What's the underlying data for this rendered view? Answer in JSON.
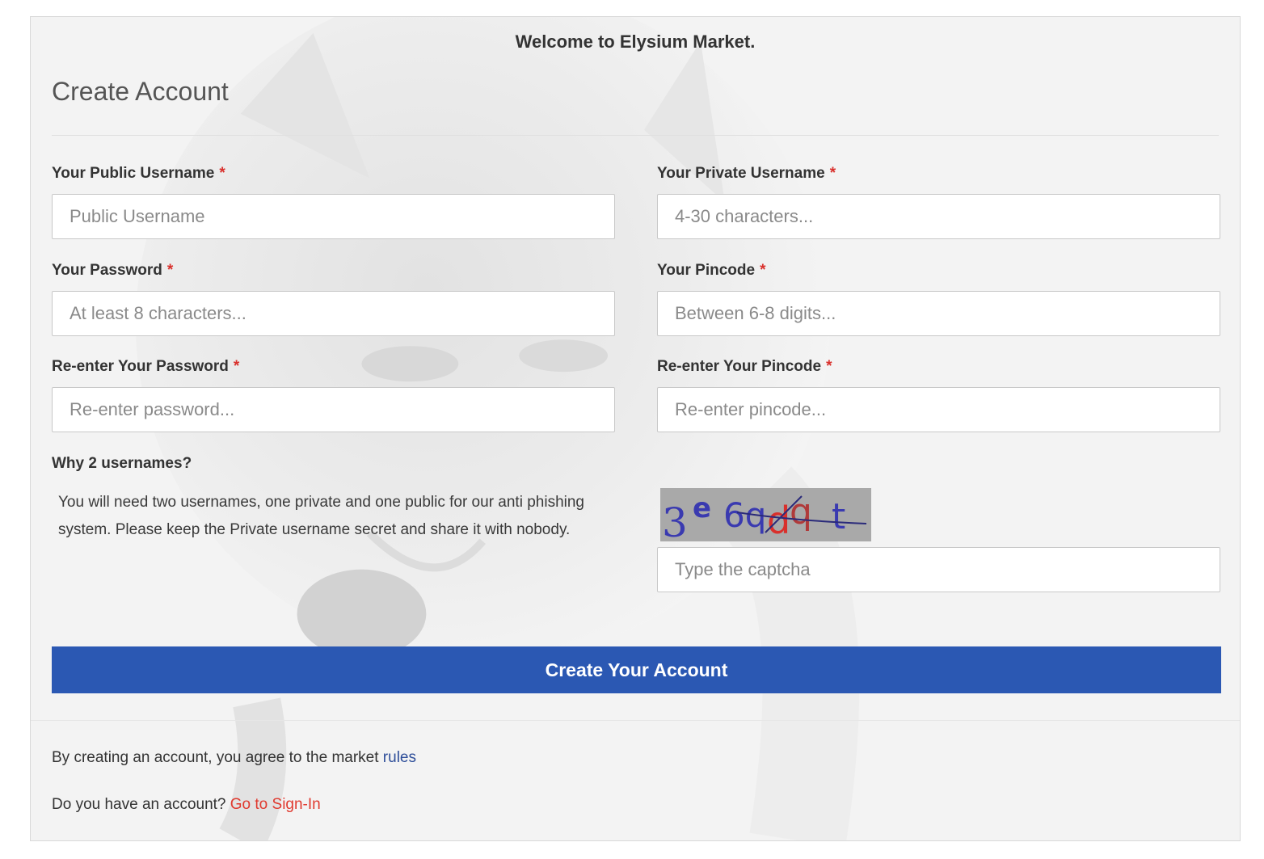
{
  "header": {
    "welcome": "Welcome to Elysium Market.",
    "title": "Create Account"
  },
  "fields": {
    "public_username": {
      "label": "Your Public Username",
      "required_mark": "*",
      "placeholder": "Public Username",
      "value": ""
    },
    "private_username": {
      "label": "Your Private Username",
      "required_mark": "*",
      "placeholder": "4-30 characters...",
      "value": ""
    },
    "password": {
      "label": "Your Password",
      "required_mark": "*",
      "placeholder": "At least 8 characters...",
      "value": ""
    },
    "pincode": {
      "label": "Your Pincode",
      "required_mark": "*",
      "placeholder": "Between 6-8 digits...",
      "value": ""
    },
    "password_confirm": {
      "label": "Re-enter Your Password",
      "required_mark": "*",
      "placeholder": "Re-enter password...",
      "value": ""
    },
    "pincode_confirm": {
      "label": "Re-enter Your Pincode",
      "required_mark": "*",
      "placeholder": "Re-enter pincode...",
      "value": ""
    },
    "captcha": {
      "placeholder": "Type the captcha",
      "value": ""
    }
  },
  "info": {
    "title": "Why 2 usernames?",
    "body": "You will need two usernames, one private and one public for our anti phishing system. Please keep the Private username secret and share it with nobody."
  },
  "captcha_image": {
    "text": "3e6qdqt",
    "colors": [
      "#3a3ab0",
      "#d9302c"
    ]
  },
  "submit": {
    "label": "Create Your Account",
    "color": "#2b58b3"
  },
  "footer": {
    "rules_text": "By creating an account, you agree to the market ",
    "rules_link": "rules",
    "signin_text": "Do you have an account? ",
    "signin_link": "Go to Sign-In"
  },
  "colors": {
    "required": "#d9302c",
    "link": "#2f4f9a",
    "signin_link": "#e03a2f"
  }
}
